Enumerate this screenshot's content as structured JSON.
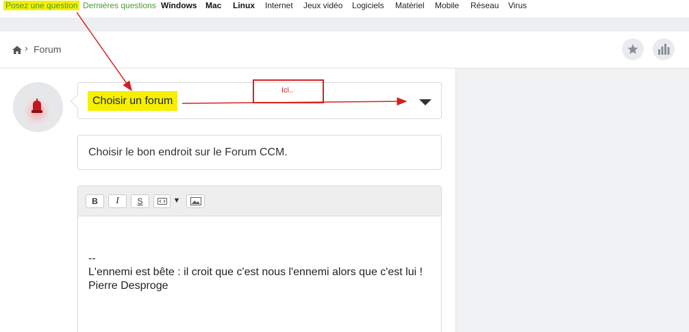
{
  "topnav": {
    "items": [
      {
        "label": "Posez une question",
        "style": "green-highlight"
      },
      {
        "label": "Dernières questions",
        "style": "green"
      },
      {
        "label": "Windows",
        "style": "bold"
      },
      {
        "label": "Mac",
        "style": "bold"
      },
      {
        "label": "Linux",
        "style": "bold"
      },
      {
        "label": "Internet",
        "style": "normal"
      },
      {
        "label": "Jeux vidéo",
        "style": "normal"
      },
      {
        "label": "Logiciels",
        "style": "normal"
      },
      {
        "label": "Matériel",
        "style": "normal"
      },
      {
        "label": "Mobile",
        "style": "normal"
      },
      {
        "label": "Réseau",
        "style": "normal"
      },
      {
        "label": "Virus",
        "style": "normal"
      }
    ]
  },
  "breadcrumb": {
    "home_icon": "home-icon",
    "separator": "›",
    "current": "Forum"
  },
  "actions": {
    "favorite_icon": "star-icon",
    "stats_icon": "bar-chart-icon"
  },
  "form": {
    "forum_select_label": "Choisir un forum",
    "annotation_label": "Ici..",
    "title_value": "Choisir le bon endroit sur le Forum CCM.",
    "toolbar": {
      "bold": "B",
      "italic": "I",
      "strike": "S",
      "code_icon": "code-icon",
      "dropdown": "▼",
      "image_icon": "image-icon"
    },
    "body_lines": [
      "--",
      "L'ennemi est bête : il croit que c'est nous l'ennemi alors que c'est lui !",
      "Pierre Desproge"
    ]
  },
  "colors": {
    "highlight": "#f4f000",
    "annotation_red": "#d42020",
    "nav_green": "#4a9a2e",
    "panel_gray": "#f1f2f4"
  }
}
